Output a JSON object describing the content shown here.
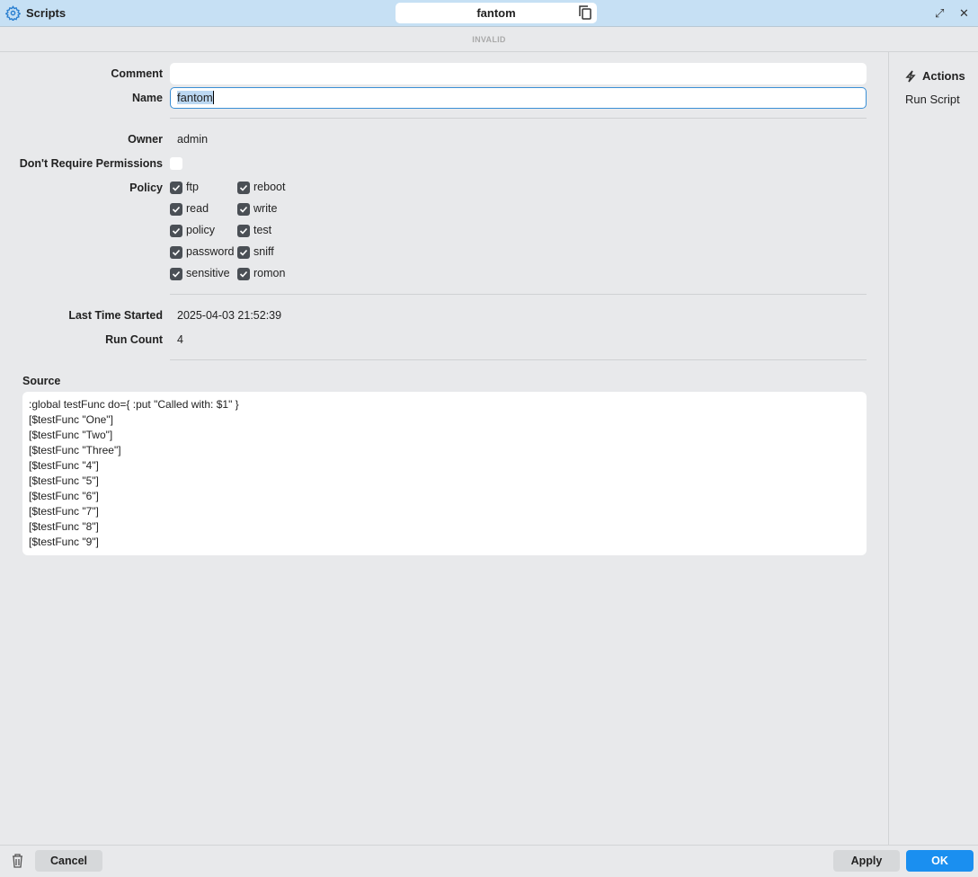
{
  "window": {
    "title": "Scripts",
    "center_title": "fantom",
    "status": "INVALID"
  },
  "form": {
    "comment_label": "Comment",
    "comment_value": "",
    "name_label": "Name",
    "name_value": "fantom",
    "owner_label": "Owner",
    "owner_value": "admin",
    "dont_require_label": "Don't Require Permissions",
    "dont_require_checked": false,
    "policy_label": "Policy",
    "policies": [
      {
        "label": "ftp",
        "checked": true
      },
      {
        "label": "reboot",
        "checked": true
      },
      {
        "label": "read",
        "checked": true
      },
      {
        "label": "write",
        "checked": true
      },
      {
        "label": "policy",
        "checked": true
      },
      {
        "label": "test",
        "checked": true
      },
      {
        "label": "password",
        "checked": true
      },
      {
        "label": "sniff",
        "checked": true
      },
      {
        "label": "sensitive",
        "checked": true
      },
      {
        "label": "romon",
        "checked": true
      }
    ],
    "last_started_label": "Last Time Started",
    "last_started_value": "2025-04-03 21:52:39",
    "run_count_label": "Run Count",
    "run_count_value": "4",
    "source_label": "Source",
    "source_lines": [
      ":global testFunc do={ :put \"Called with: $1\" }",
      "[$testFunc \"One\"]",
      "[$testFunc \"Two\"]",
      "[$testFunc \"Three\"]",
      "[$testFunc \"4\"]",
      "[$testFunc \"5\"]",
      "[$testFunc \"6\"]",
      "[$testFunc \"7\"]",
      "[$testFunc \"8\"]",
      "[$testFunc \"9\"]"
    ]
  },
  "sidebar": {
    "actions_label": "Actions",
    "run_script": "Run Script"
  },
  "footer": {
    "cancel": "Cancel",
    "apply": "Apply",
    "ok": "OK"
  }
}
